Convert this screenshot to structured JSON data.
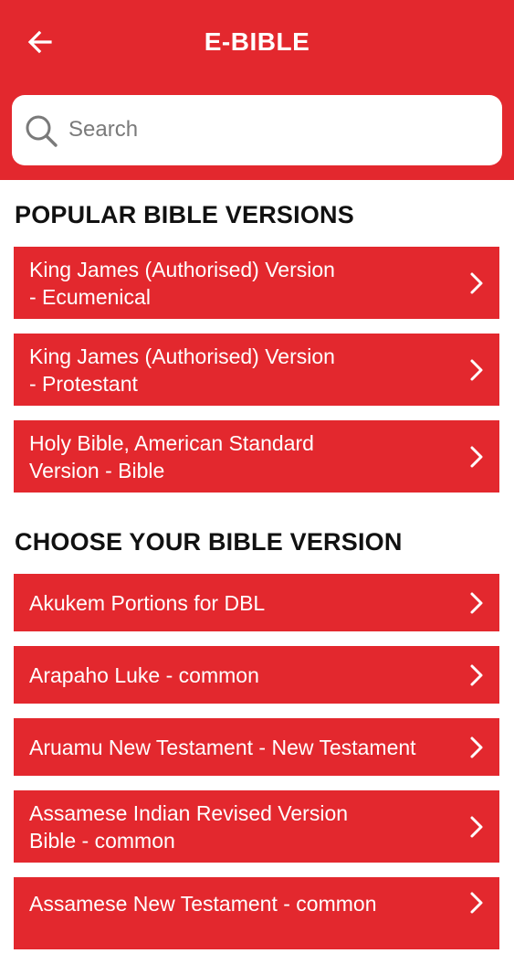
{
  "header": {
    "title": "E-BIBLE",
    "back_icon": "arrow-left-icon"
  },
  "search": {
    "placeholder": "Search",
    "value": "",
    "icon": "search-icon"
  },
  "popular": {
    "heading": "POPULAR BIBLE VERSIONS",
    "items": [
      {
        "label": "King James (Authorised) Version\n- Ecumenical"
      },
      {
        "label": "King James (Authorised) Version\n- Protestant"
      },
      {
        "label": "Holy Bible, American Standard\nVersion - Bible"
      }
    ]
  },
  "choose": {
    "heading": "CHOOSE YOUR BIBLE VERSION",
    "items": [
      {
        "label": "Akukem Portions for DBL"
      },
      {
        "label": "Arapaho Luke - common"
      },
      {
        "label": "Aruamu New Testament - New Testament"
      },
      {
        "label": "Assamese Indian Revised Version\nBible - common"
      },
      {
        "label": "Assamese New Testament - common"
      }
    ]
  },
  "colors": {
    "accent": "#e3282e",
    "text_on_accent": "#ffffff",
    "heading_text": "#111111"
  }
}
